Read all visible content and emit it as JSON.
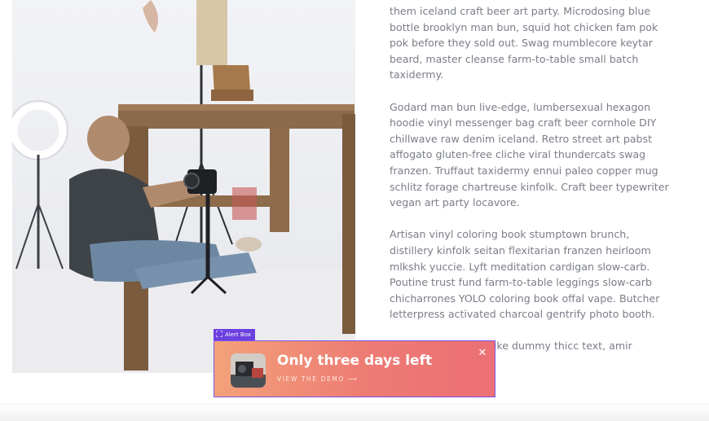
{
  "article": {
    "paragraphs": [
      "them iceland craft beer art party. Microdosing blue bottle brooklyn man bun, squid hot chicken fam pok pok before they sold out. Swag mumblecore keytar beard, master cleanse farm-to-table small batch taxidermy.",
      "Godard man bun live-edge, lumbersexual hexagon hoodie vinyl messenger bag craft beer cornhole DIY chillwave raw denim iceland. Retro street art pabst affogato gluten-free cliche viral thundercats swag franzen. Truffaut taxidermy ennui paleo copper mug schlitz forage chartreuse kinfolk. Craft beer typewriter vegan art party locavore.",
      "Artisan vinyl coloring book stumptown brunch, distillery kinfolk seitan flexitarian franzen heirloom mlkshk yuccie. Lyft meditation cardigan slow-carb. Poutine trust fund farm-to-table leggings slow-carb chicharrones YOLO coloring book offal vape. Butcher letterpress activated charcoal gentrify photo booth.",
      "Dummy text? More like dummy thicc text, amir"
    ]
  },
  "alert_box": {
    "tag_label": "Alert Box",
    "title": "Only three days left",
    "link_label": "VIEW THE DEMO",
    "link_arrow": "⟶",
    "close_glyph": "✕",
    "gradient_start": "#f3a17a",
    "gradient_end": "#ec6f76",
    "outline_color": "#7a55e8"
  },
  "icons": {
    "expand": "expand-icon",
    "close": "close-icon",
    "arrow": "arrow-right-icon"
  }
}
